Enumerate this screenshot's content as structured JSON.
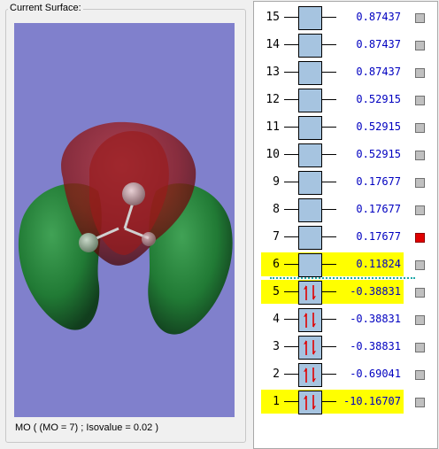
{
  "surface_panel": {
    "title": "Current Surface:",
    "status": "MO ( (MO = 7) ; Isovalue = 0.02 )"
  },
  "colors": {
    "background": "#8080cc",
    "positive_lobe": "#8a1616",
    "negative_lobe": "#1e7a30",
    "orbital_box": "#a6c4e0",
    "highlight": "#ffff00",
    "energy_text": "#0000c0",
    "selected_marker": "#e00000",
    "marker": "#c0c0c0"
  },
  "orbitals": [
    {
      "num": "15",
      "energy": "0.87437",
      "occupied": false,
      "highlighted": false,
      "selected": false
    },
    {
      "num": "14",
      "energy": "0.87437",
      "occupied": false,
      "highlighted": false,
      "selected": false
    },
    {
      "num": "13",
      "energy": "0.87437",
      "occupied": false,
      "highlighted": false,
      "selected": false
    },
    {
      "num": "12",
      "energy": "0.52915",
      "occupied": false,
      "highlighted": false,
      "selected": false
    },
    {
      "num": "11",
      "energy": "0.52915",
      "occupied": false,
      "highlighted": false,
      "selected": false
    },
    {
      "num": "10",
      "energy": "0.52915",
      "occupied": false,
      "highlighted": false,
      "selected": false
    },
    {
      "num": "9",
      "energy": "0.17677",
      "occupied": false,
      "highlighted": false,
      "selected": false
    },
    {
      "num": "8",
      "energy": "0.17677",
      "occupied": false,
      "highlighted": false,
      "selected": false
    },
    {
      "num": "7",
      "energy": "0.17677",
      "occupied": false,
      "highlighted": false,
      "selected": true
    },
    {
      "num": "6",
      "energy": "0.11824",
      "occupied": false,
      "highlighted": true,
      "selected": false
    },
    {
      "num": "5",
      "energy": "-0.38831",
      "occupied": true,
      "highlighted": true,
      "selected": false
    },
    {
      "num": "4",
      "energy": "-0.38831",
      "occupied": true,
      "highlighted": false,
      "selected": false
    },
    {
      "num": "3",
      "energy": "-0.38831",
      "occupied": true,
      "highlighted": false,
      "selected": false
    },
    {
      "num": "2",
      "energy": "-0.69041",
      "occupied": true,
      "highlighted": false,
      "selected": false
    },
    {
      "num": "1",
      "energy": "-10.16707",
      "occupied": true,
      "highlighted": true,
      "selected": false
    }
  ]
}
